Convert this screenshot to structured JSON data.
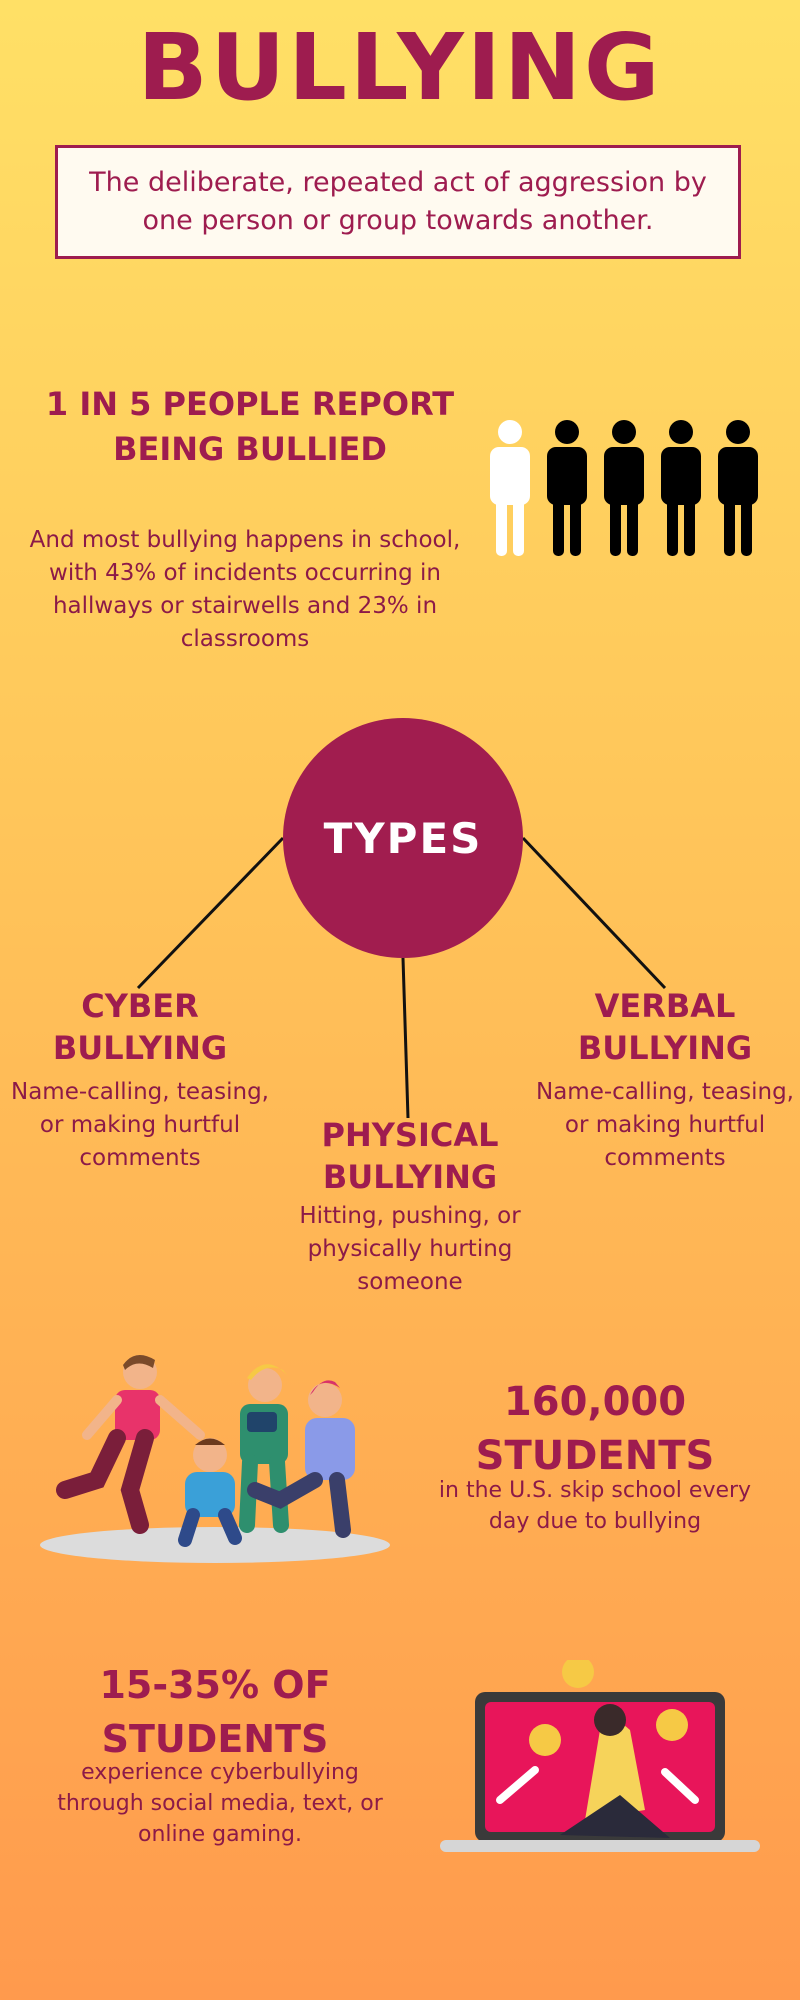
{
  "title": "BULLYING",
  "definition": "The deliberate, repeated act of aggression by one person or group towards another.",
  "stat_one": {
    "heading": "1 IN 5 PEOPLE REPORT BEING BULLIED",
    "body": "And most bullying happens in school, with 43% of incidents occurring in hallways or stairwells and 23% in classrooms",
    "figures_total": 5,
    "figures_highlighted": 1
  },
  "types": {
    "label": "TYPES",
    "cyber": {
      "heading": "CYBER BULLYING",
      "body": "Name-calling, teasing, or making hurtful comments"
    },
    "physical": {
      "heading": "PHYSICAL BULLYING",
      "body": "Hitting, pushing, or physically hurting someone"
    },
    "verbal": {
      "heading": "VERBAL BULLYING",
      "body": "Name-calling, teasing, or making hurtful comments"
    }
  },
  "stat_two": {
    "heading": "160,000 STUDENTS",
    "body": "in the U.S. skip school every day due to bullying"
  },
  "stat_three": {
    "heading": "15-35% OF STUDENTS",
    "body": "experience cyberbullying through social media, text, or online gaming."
  },
  "colors": {
    "accent": "#9e1c4f",
    "circle": "#a11d4f",
    "bg_top": "#ffe066",
    "bg_bottom": "#ff9a4d"
  }
}
